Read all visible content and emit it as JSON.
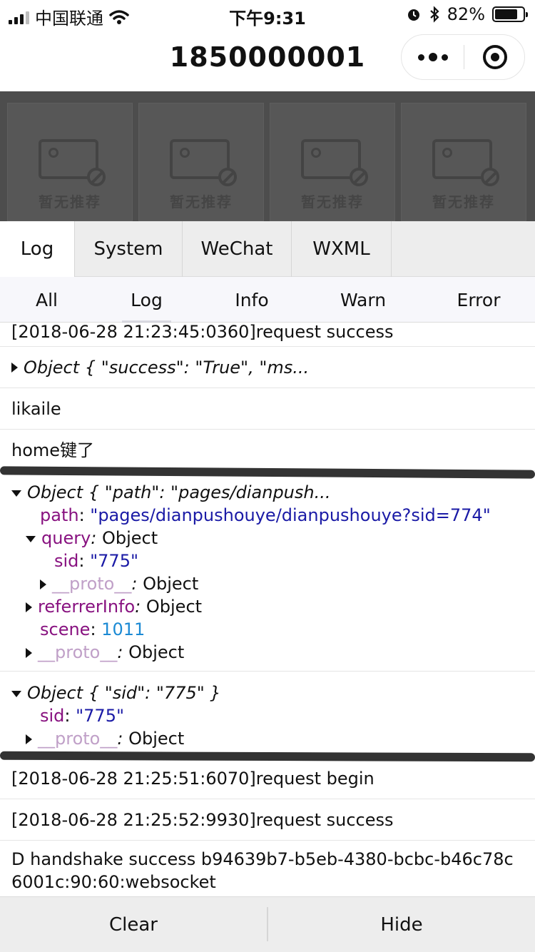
{
  "status_bar": {
    "carrier": "中国联通",
    "time": "下午9:31",
    "battery": "82%",
    "battery_level": 0.82
  },
  "nav": {
    "title": "1850000001"
  },
  "page": {
    "placeholder_label": "暂无推荐"
  },
  "console": {
    "tabs": [
      "Log",
      "System",
      "WeChat",
      "WXML"
    ],
    "active_tab": "Log",
    "filters": [
      "All",
      "Log",
      "Info",
      "Warn",
      "Error"
    ],
    "active_filter": "Log",
    "logs": {
      "l1": "[2018-06-28 21:23:45:0360]request success",
      "l2": "Object { \"success\": \"True\", \"ms...",
      "l3": "likaile",
      "l4": "home键了",
      "obj1": {
        "summary": "Object { \"path\": \"pages/dianpush...",
        "path_key": "path",
        "path_val": "\"pages/dianpushouye/dianpushouye?sid=774\"",
        "query_key": "query",
        "query_val": "Object",
        "sid_key": "sid",
        "sid_val": "\"775\"",
        "proto_key": "__proto__",
        "proto_val": "Object",
        "ref_key": "referrerInfo",
        "ref_val": "Object",
        "scene_key": "scene",
        "scene_val": "1011"
      },
      "obj2": {
        "summary": "Object { \"sid\": \"775\" }",
        "sid_key": "sid",
        "sid_val": "\"775\"",
        "proto_key": "__proto__",
        "proto_val": "Object"
      },
      "l5": "[2018-06-28 21:25:51:6070]request begin",
      "l6": "[2018-06-28 21:25:52:9930]request success",
      "l7": "D handshake success b94639b7-b5eb-4380-bcbc-b46c78c6001c:90:60:websocket"
    },
    "footer": {
      "clear": "Clear",
      "hide": "Hide"
    }
  },
  "colors": {
    "key": "#881280",
    "string": "#1a1aa6",
    "number": "#1c8ad4",
    "overlay": "#4d4d4d"
  }
}
